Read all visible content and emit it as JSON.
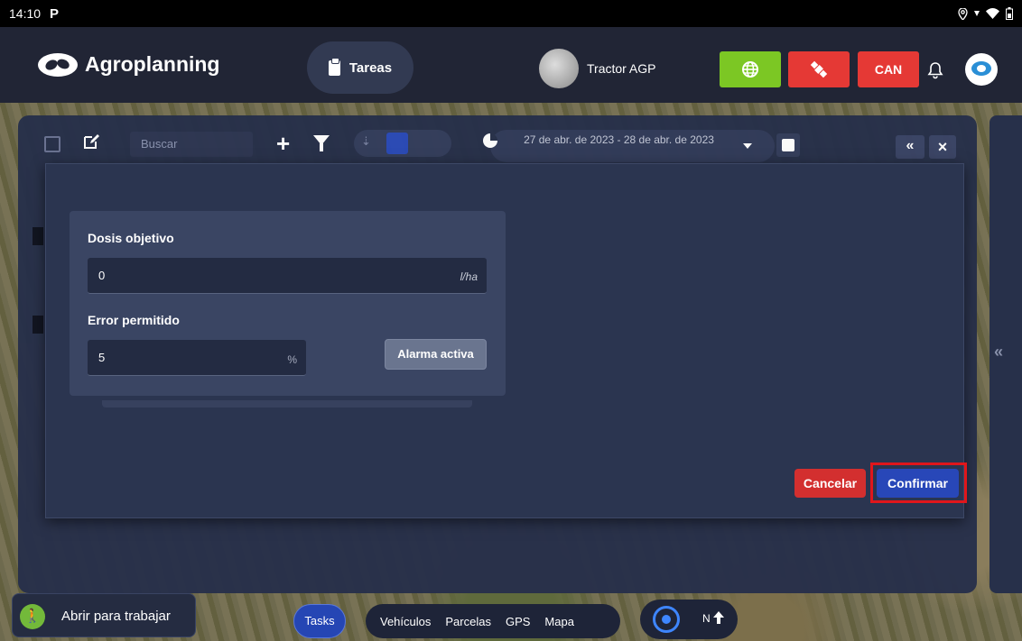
{
  "status_bar": {
    "time": "14:10",
    "app_indicator": "P",
    "icons": [
      "location-icon",
      "signal-icon",
      "wifi-icon",
      "battery-icon"
    ]
  },
  "header": {
    "brand": "Agroplanning",
    "tareas_label": "Tareas",
    "vehicle_name": "Tractor AGP",
    "can_label": "CAN",
    "colors": {
      "green": "#7cc724",
      "red": "#e53935",
      "background": "#212535"
    }
  },
  "toolbar": {
    "search_placeholder": "Buscar",
    "date_range": "27 de abr. de 2023 - 28 de abr. de 2023"
  },
  "dialog": {
    "target_dose": {
      "label": "Dosis objetivo",
      "value": "0",
      "unit": "l/ha"
    },
    "allowed_error": {
      "label": "Error permitido",
      "value": "5",
      "unit": "%"
    },
    "alarm_button": "Alarma activa",
    "cancel_label": "Cancelar",
    "confirm_label": "Confirmar",
    "colors": {
      "cancel": "#d32f2f",
      "confirm": "#2847b8",
      "highlight": "#e0161b"
    }
  },
  "bottom_bar": {
    "work_button": "Abrir para trabajar",
    "tasks_label": "Tasks",
    "nav_items": [
      "Vehículos",
      "Parcelas",
      "GPS",
      "Mapa"
    ],
    "north_label": "N"
  }
}
